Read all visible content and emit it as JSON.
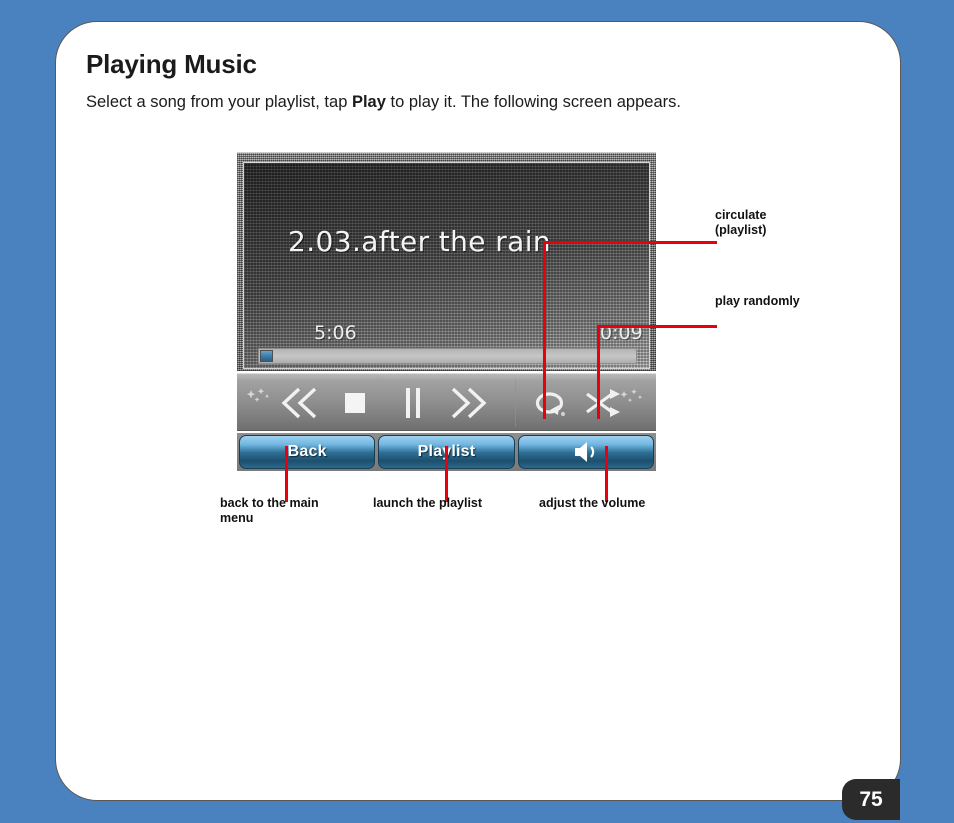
{
  "page": {
    "title": "Playing Music",
    "intro_before": "Select a song from your playlist, tap ",
    "intro_bold": "Play",
    "intro_after": " to play it. The following screen appears.",
    "number": "75",
    "background_color": "#4a82c0",
    "card_color": "#ffffff",
    "callout_color": "#e8000d"
  },
  "device": {
    "screen": {
      "track_title": "2.03.after the rain",
      "total_time": "5:06",
      "elapsed_time": "0:09",
      "progress_percent": 3
    },
    "transport": {
      "buttons": [
        {
          "name": "previous-track-button",
          "label": "Previous"
        },
        {
          "name": "stop-button",
          "label": "Stop"
        },
        {
          "name": "pause-button",
          "label": "Pause"
        },
        {
          "name": "next-track-button",
          "label": "Next"
        },
        {
          "name": "repeat-button",
          "label": "Repeat"
        },
        {
          "name": "shuffle-button",
          "label": "Shuffle"
        }
      ]
    },
    "softkeys": [
      {
        "name": "back-button",
        "label": "Back"
      },
      {
        "name": "playlist-button",
        "label": "Playlist"
      },
      {
        "name": "volume-button",
        "label": ""
      }
    ]
  },
  "annotations": {
    "circulate": "circulate\n(playlist)",
    "circulate_line1": "circulate",
    "circulate_line2": "(playlist)",
    "random": "play randomly",
    "back": "back to the main\nmenu",
    "back_line1": "back to the main",
    "back_line2": "menu",
    "playlist": "launch the playlist",
    "volume": "adjust the volume"
  }
}
